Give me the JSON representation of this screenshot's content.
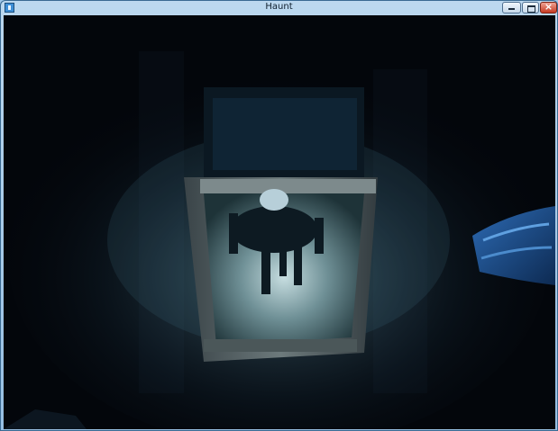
{
  "window": {
    "title": "Haunt"
  },
  "icons": {
    "app": "app-icon",
    "minimize": "minimize-icon",
    "maximize": "maximize-icon",
    "close": "close-icon"
  },
  "colors": {
    "titlebar": "#a9cbea",
    "close": "#c63a22",
    "scene_dark": "#03060b",
    "glow": "#7fb3c8"
  }
}
